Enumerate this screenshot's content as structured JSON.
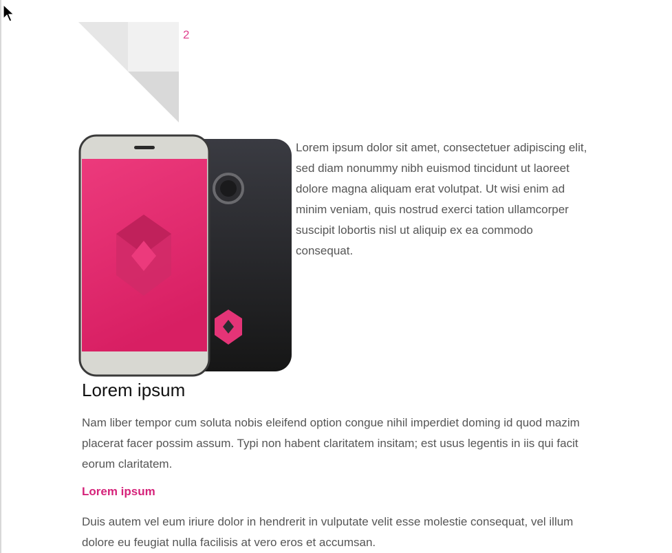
{
  "marker": {
    "page_number": "2"
  },
  "colors": {
    "accent": "#d5237a",
    "spellcheck_underline": "#e5534b",
    "phone_screen": "#e43477",
    "phone_back": "#2a2b30"
  },
  "icons": {
    "cursor": "mouse-pointer-icon",
    "corner": "page-corner-fold-icon",
    "phone": "smartphone-illustration"
  },
  "article": {
    "intro_text": "Lorem ipsum dolor sit amet, consectetuer adipiscing elit, sed diam nonummy nibh euismod tincidunt ut laoreet dolore magna aliquam erat volutpat. Ut wisi enim ad minim veniam, quis nostrud exerci tation ullamcorper suscipit lobortis nisl ut aliquip ex ea commodo consequat.",
    "heading": "Lorem ipsum",
    "paragraph_1": "Nam liber tempor cum soluta nobis eleifend option congue nihil imperdiet doming id quod mazim placerat facer possim assum. Typi non habent claritatem insitam; est usus legentis in iis qui facit eorum claritatem.",
    "subheading": "Lorem ipsum",
    "paragraph_2": "Duis autem vel eum iriure dolor in hendrerit in vulputate velit esse molestie consequat, vel illum dolore eu feugiat nulla facilisis at vero eros et accumsan."
  }
}
